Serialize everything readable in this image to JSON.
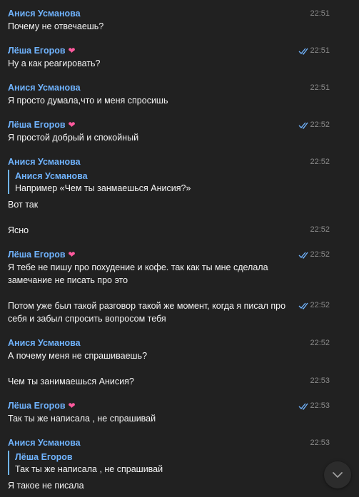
{
  "colors": {
    "background": "#212121",
    "accent": "#70b4ff",
    "heart": "#ff5a9e",
    "timestamp": "#8a8a8a",
    "text": "#f5f5f5"
  },
  "messages": [
    {
      "author": "Анися Усманова",
      "time": "22:51",
      "text": "Почему не отвечаешь?"
    },
    {
      "author": "Лёша Егоров",
      "heart": "❤",
      "time": "22:51",
      "read": true,
      "text": "Ну а как реагировать?"
    },
    {
      "author": "Анися Усманова",
      "time": "22:51",
      "text": "Я просто думала,что и меня спросишь"
    },
    {
      "author": "Лёша Егоров",
      "heart": "❤",
      "time": "22:52",
      "read": true,
      "text": "Я простой добрый и спокойный"
    },
    {
      "author": "Анися Усманова",
      "time": "22:52",
      "reply": {
        "author": "Анися Усманова",
        "text": "Например «Чем ты занмаешься Анисия?»"
      },
      "text": "Вот так"
    },
    {
      "time": "22:52",
      "text": "Ясно"
    },
    {
      "author": "Лёша Егоров",
      "heart": "❤",
      "time": "22:52",
      "read": true,
      "text": "Я тебе не пишу про похудение и кофе. так как ты мне сделала замечание не писать про это"
    },
    {
      "time": "22:52",
      "read": true,
      "text": "Потом уже был такой разговор такой же момент, когда я писал про себя и забыл спросить вопросом тебя"
    },
    {
      "author": "Анися Усманова",
      "time": "22:52",
      "text": "А почему меня не спрашиваешь?"
    },
    {
      "time": "22:53",
      "text": "Чем ты занимаешься Анисия?"
    },
    {
      "author": "Лёша Егоров",
      "heart": "❤",
      "time": "22:53",
      "read": true,
      "text": "Так ты же написала , не спрашивай"
    },
    {
      "author": "Анися Усманова",
      "time": "22:53",
      "reply": {
        "author": "Лёша Егоров",
        "text": "Так ты же написала , не спрашивай"
      },
      "text": "Я такое не писала"
    }
  ],
  "scroll_button": {
    "icon": "chevron-down-icon"
  }
}
